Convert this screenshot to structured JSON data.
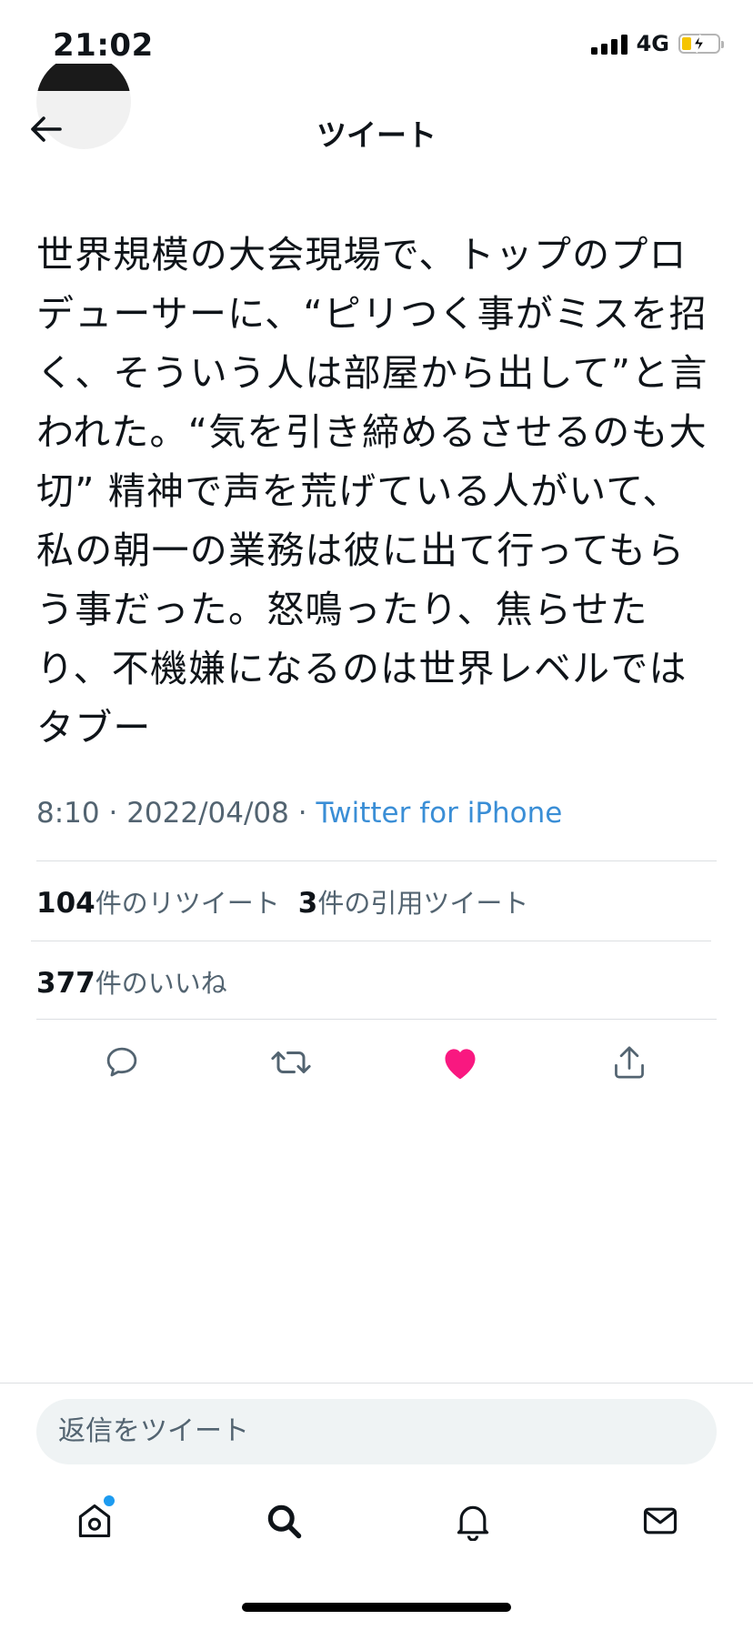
{
  "status_bar": {
    "time": "21:02",
    "network": "4G"
  },
  "header": {
    "title": "ツイート"
  },
  "tweet": {
    "text": "世界規模の大会現場で、トップのプロデューサーに、“ピリつく事がミスを招く、そういう人は部屋から出して”と言われた。“気を引き締めるさせるのも大切” 精神で声を荒げている人がいて、私の朝一の業務は彼に出て行ってもらう事だった。怒鳴ったり、焦らせたり、不機嫌になるのは世界レベルではタブー",
    "time": "8:10",
    "date": "2022/04/08",
    "separator": "·",
    "source": "Twitter for iPhone"
  },
  "stats": {
    "retweets_count": "104",
    "retweets_label": "件のリツイート",
    "quotes_count": "3",
    "quotes_label": "件の引用ツイート",
    "likes_count": "377",
    "likes_label": "件のいいね"
  },
  "actions": {
    "reply_icon": "reply-icon",
    "retweet_icon": "retweet-icon",
    "like_icon": "heart-filled-icon",
    "share_icon": "share-icon",
    "like_color": "#f91880"
  },
  "reply": {
    "placeholder": "返信をツイート"
  },
  "tab_bar": {
    "tabs": [
      "home-icon",
      "search-icon",
      "notifications-icon",
      "messages-icon"
    ],
    "badge_color": "#1d9bf0"
  }
}
